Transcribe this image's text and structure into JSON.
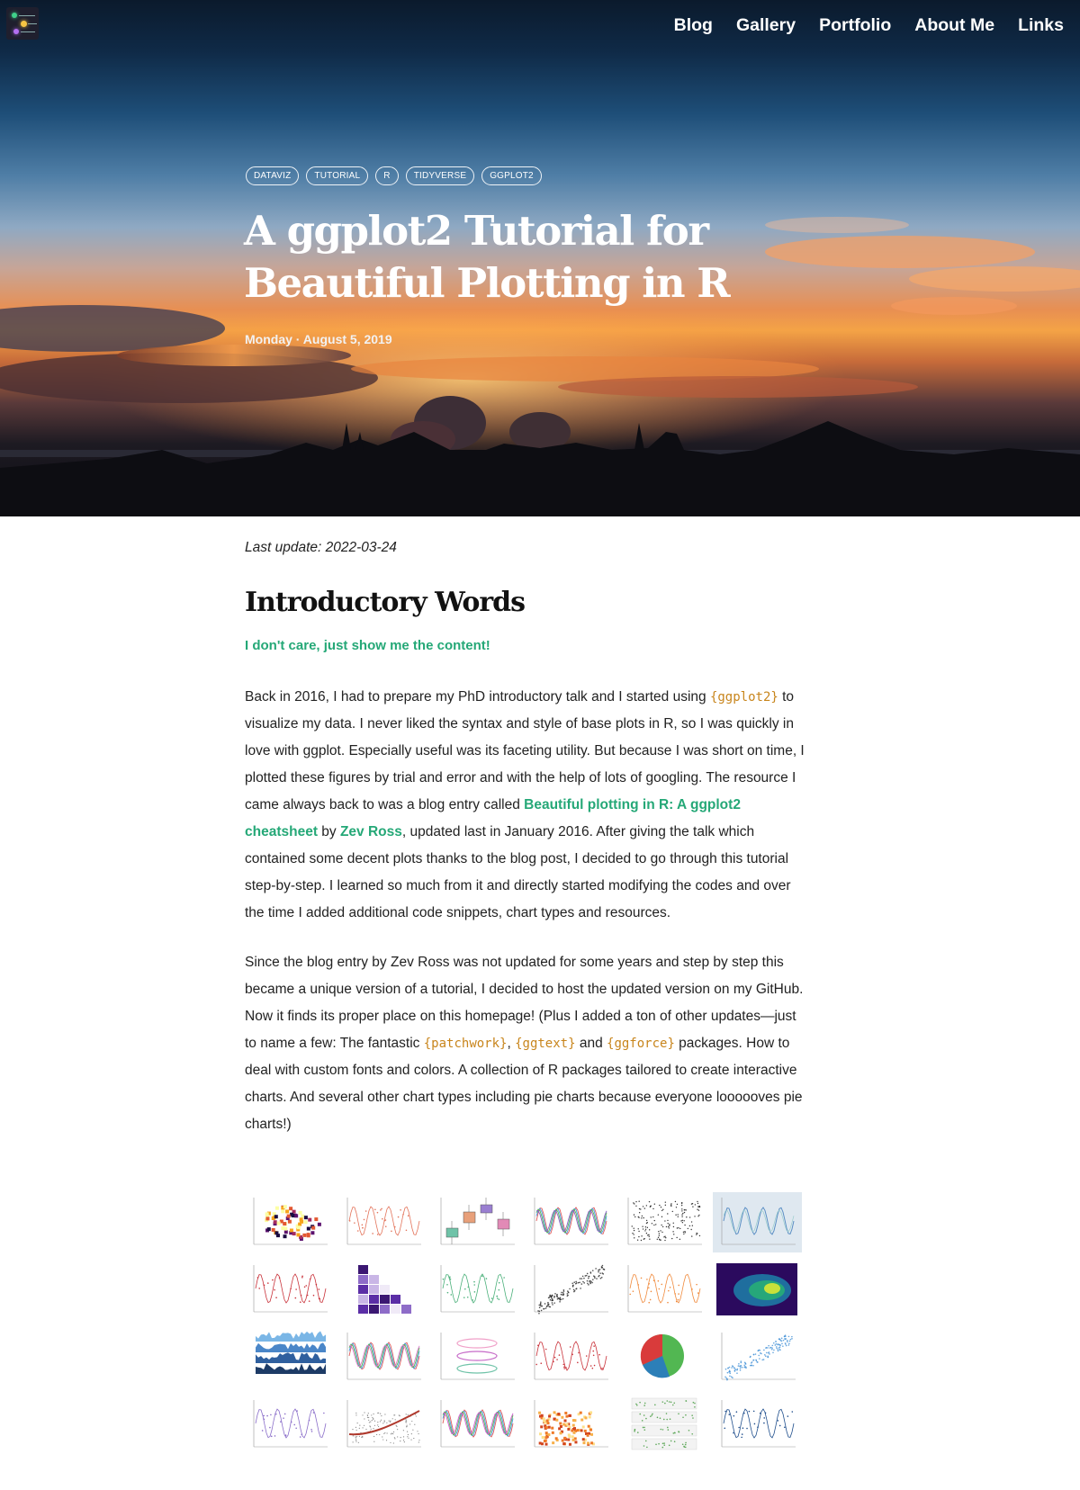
{
  "nav": {
    "items": [
      {
        "label": "Blog"
      },
      {
        "label": "Gallery"
      },
      {
        "label": "Portfolio"
      },
      {
        "label": "About Me"
      },
      {
        "label": "Links"
      }
    ]
  },
  "hero": {
    "tags": [
      "DATAVIZ",
      "TUTORIAL",
      "R",
      "TIDYVERSE",
      "GGPLOT2"
    ],
    "title_line1": "A ggplot2 Tutorial for",
    "title_line2": "Beautiful Plotting in R",
    "date": "Monday · August 5, 2019"
  },
  "article": {
    "last_update": "Last update: 2022-03-24",
    "section_title": "Introductory Words",
    "skip_link": "I don't care, just show me the content!",
    "p1": {
      "t1": "Back in 2016, I had to prepare my PhD introductory talk and I started using ",
      "code1": "{ggplot2}",
      "t2": " to visualize my data. I never liked the syntax and style of base plots in R, so I was quickly in love with ggplot. Especially useful was its faceting utility. But because I was short on time, I plotted these figures by trial and error and with the help of lots of googling. The resource I came always back to was a blog entry called ",
      "link1": "Beautiful plotting in R: A ggplot2 cheatsheet",
      "t3": " by ",
      "link2": "Zev Ross",
      "t4": ", updated last in January 2016. After giving the talk which contained some decent plots thanks to the blog post, I decided to go through this tutorial step-by-step. I learned so much from it and directly started modifying the codes and over the time I added additional code snippets, chart types and resources."
    },
    "p2": {
      "t1": "Since the blog entry by Zev Ross was not updated for some years and step by step this became a unique version of a tutorial, I decided to host the updated version on my GitHub. Now it finds its proper place on this homepage! (Plus I added a ton of other updates—just to name a few: The fantastic ",
      "code1": "{patchwork}",
      "t2": ", ",
      "code2": "{ggtext}",
      "t3": " and ",
      "code3": "{ggforce}",
      "t4": " packages. How to deal with custom fonts and colors. A collection of R packages tailored to create interactive charts. And several other chart types including pie charts because everyone loooooves pie charts!)"
    }
  },
  "gallery": {
    "thumbnails": [
      {
        "kind": "hex",
        "color": "#e06b2c"
      },
      {
        "kind": "lines",
        "color": "#e3735a"
      },
      {
        "kind": "box",
        "color": "#d48fb0"
      },
      {
        "kind": "lines-multi",
        "color": "#8a5ec7"
      },
      {
        "kind": "scatter",
        "color": "#333333"
      },
      {
        "kind": "lines-panel",
        "color": "#5b8fc4"
      },
      {
        "kind": "lines",
        "color": "#c9323a"
      },
      {
        "kind": "corr",
        "color": "#5b2ea6"
      },
      {
        "kind": "lines",
        "color": "#4bb07a"
      },
      {
        "kind": "scatter-line",
        "color": "#222222"
      },
      {
        "kind": "lines",
        "color": "#f08a3c"
      },
      {
        "kind": "density",
        "color": "#3b1f8a"
      },
      {
        "kind": "ridge",
        "color": "#2f5f9e"
      },
      {
        "kind": "lines-multi",
        "color": "#e07ad0"
      },
      {
        "kind": "violin",
        "color": "#c66bc8"
      },
      {
        "kind": "lines",
        "color": "#c9323a"
      },
      {
        "kind": "pie",
        "color": "#2c7fb8"
      },
      {
        "kind": "scatter-line",
        "color": "#3f8fd6"
      },
      {
        "kind": "lines",
        "color": "#8a6dc9"
      },
      {
        "kind": "smooth",
        "color": "#b03a2e"
      },
      {
        "kind": "lines-multi",
        "color": "#d25bd1"
      },
      {
        "kind": "heat",
        "color": "#e8902b"
      },
      {
        "kind": "facets",
        "color": "#5fa85a"
      },
      {
        "kind": "lines",
        "color": "#1f4e8c"
      }
    ]
  }
}
